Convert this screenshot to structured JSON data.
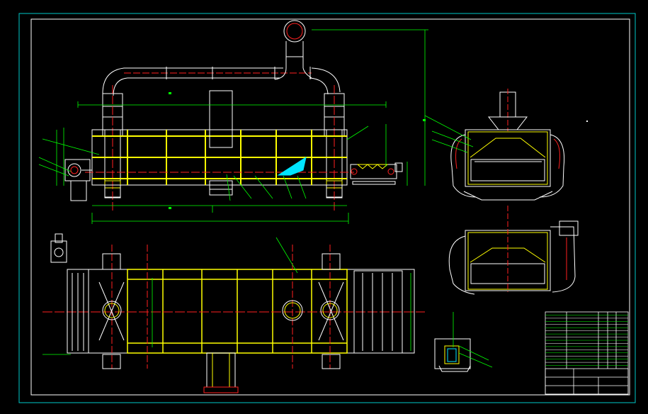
{
  "drawing": {
    "background": "#000000",
    "colors": {
      "frame": "#00c8c8",
      "body": "#ffffff",
      "structure": "#ffff00",
      "centerline": "#ff2020",
      "dimension": "#00ff00",
      "hatch": "#00e5ff",
      "pipe_core": "#ff2020"
    },
    "views": [
      {
        "name": "front-elevation"
      },
      {
        "name": "plan-view"
      },
      {
        "name": "side-section-upper"
      },
      {
        "name": "side-section-lower"
      },
      {
        "name": "detail-section"
      }
    ],
    "title_block": {
      "rows": 18,
      "columns": 6
    }
  }
}
